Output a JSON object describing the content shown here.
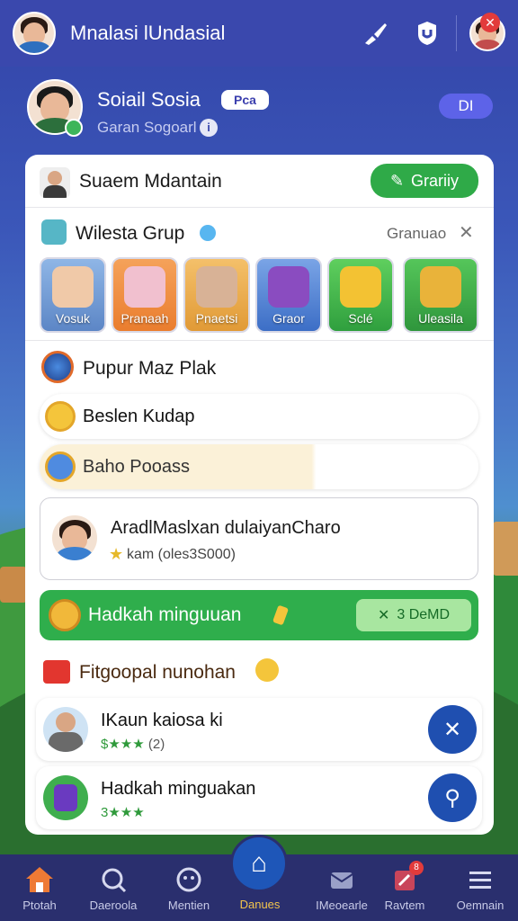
{
  "app": {
    "title": "Mnalasi lUndasial"
  },
  "profile": {
    "name": "Soiail Sosia",
    "badge": "Pca",
    "subtitle": "Garan Sogoarl",
    "info_glyph": "i",
    "pill": "DI"
  },
  "card": {
    "header": {
      "title": "Suaem Mdantain",
      "button": "Grariiy"
    },
    "group": {
      "title": "Wilesta Grup",
      "action": "Granuao",
      "tiles": [
        {
          "label": "Vosuk",
          "bg": "#6f9bd6"
        },
        {
          "label": "Pranaah",
          "bg": "#ef8a3b"
        },
        {
          "label": "Pnaetsi",
          "bg": "#e5a64a"
        },
        {
          "label": "Graor",
          "bg": "#4d7fd0"
        },
        {
          "label": "Sclé",
          "bg": "#3fb44e"
        },
        {
          "label": "Uleasila",
          "bg": "#3aa64a"
        }
      ]
    },
    "section1": {
      "title": "Pupur Maz Plak"
    },
    "list": [
      {
        "label": "Beslen Kudap"
      },
      {
        "label": "Baho Pooass"
      }
    ],
    "recommend": {
      "title": "AradlMaslxan dulaiyanCharo",
      "sub": "kam (oles3S000)"
    },
    "banner": {
      "title": "Hadkah minguuan",
      "button": "3 DeMD"
    },
    "section2": {
      "title": "Fitgoopal nunohan"
    },
    "items": [
      {
        "title": "IKaun kaiosa ki",
        "rating": "$★★★",
        "count": "(2)"
      },
      {
        "title": "Hadkah minguakan",
        "rating": "3★★★",
        "count": ""
      }
    ]
  },
  "nav": {
    "items": [
      {
        "label": "Ptotah"
      },
      {
        "label": "Daeroola"
      },
      {
        "label": "Mentien"
      },
      {
        "label": "Danues"
      },
      {
        "label": "IMeoearle"
      },
      {
        "label": "Ravtem"
      },
      {
        "label": "Oemnain"
      }
    ],
    "notification_count": "8"
  },
  "colors": {
    "topbar": "#3a48ad",
    "accent_green": "#2faa48",
    "accent_blue": "#1f4fb0",
    "navbar": "#2a2f6e"
  }
}
